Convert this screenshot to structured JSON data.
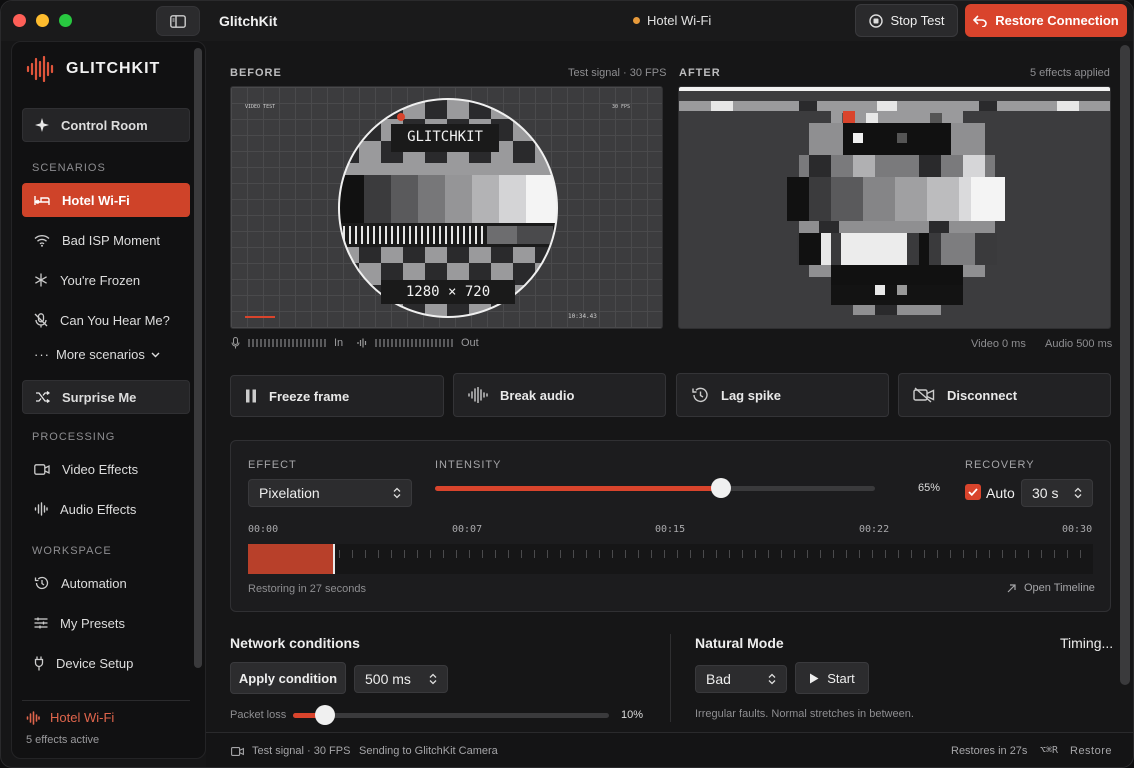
{
  "window": {
    "title": "GlitchKit",
    "status": "Hotel Wi-Fi",
    "stop_label": "Stop Test",
    "restore_label": "Restore Connection"
  },
  "sidebar": {
    "brand": "GLITCHKIT",
    "control_room": "Control Room",
    "scenarios_head": "SCENARIOS",
    "scenarios": [
      "Hotel Wi-Fi",
      "Bad ISP Moment",
      "You're Frozen",
      "Can You Hear Me?"
    ],
    "more": "More scenarios",
    "surprise": "Surprise Me",
    "processing_head": "PROCESSING",
    "processing": [
      "Video Effects",
      "Audio Effects"
    ],
    "workspace_head": "WORKSPACE",
    "workspace": [
      "Automation",
      "My Presets",
      "Device Setup"
    ],
    "footer_title": "Hotel Wi-Fi",
    "footer_sub": "5 effects active"
  },
  "preview": {
    "before_label": "BEFORE",
    "before_meta": "Test signal · 30 FPS",
    "after_label": "AFTER",
    "after_meta": "5 effects applied",
    "card_title": "GLITCHKIT",
    "card_res": "1280 × 720",
    "card_tl": "VIDEO TEST",
    "card_tr": "30 FPS",
    "card_br": "10:34.43",
    "in_label": "In",
    "out_label": "Out",
    "video_delay": "Video 0 ms",
    "audio_delay": "Audio 500 ms"
  },
  "actions": [
    "Freeze frame",
    "Break audio",
    "Lag spike",
    "Disconnect"
  ],
  "effect": {
    "effect_head": "EFFECT",
    "effect_value": "Pixelation",
    "intensity_head": "INTENSITY",
    "intensity": 0.65,
    "intensity_label": "65%",
    "recovery_head": "RECOVERY",
    "auto_label": "Auto",
    "recovery_value": "30 s",
    "timeline_labels": [
      "00:00",
      "00:07",
      "00:15",
      "00:22",
      "00:30"
    ],
    "timeline_progress": 0.1,
    "restoring": "Restoring in 27 seconds",
    "open_timeline": "Open Timeline"
  },
  "network": {
    "title": "Network conditions",
    "apply_label": "Apply condition",
    "delay_value": "500 ms",
    "packet_label": "Packet loss",
    "packet_loss": 0.1,
    "packet_value": "10%"
  },
  "natural": {
    "title": "Natural Mode",
    "timing": "Timing...",
    "mode_value": "Bad",
    "start_label": "Start",
    "desc": "Irregular faults. Normal stretches in between."
  },
  "statusbar": {
    "signal": "Test signal · 30 FPS",
    "sending": "Sending to GlitchKit Camera",
    "restores": "Restores in 27s",
    "shortcut": "⌥⌘R",
    "restore": "Restore"
  },
  "colors": {
    "accent": "#d9442c",
    "warning": "#e79a3b"
  }
}
